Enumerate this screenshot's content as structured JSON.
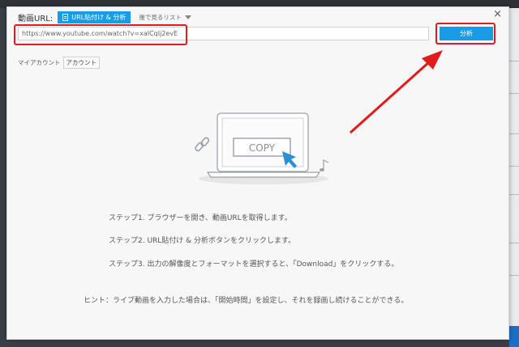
{
  "dialog": {
    "url_label": "動画URL:",
    "tabs": [
      {
        "label": "URL貼付け & 分析",
        "active": true
      },
      {
        "label": "後で見るリスト",
        "active": false
      }
    ],
    "url_value": "https://www.youtube.com/watch?v=xaICqIj2evE",
    "analyze_label": "分析",
    "account": {
      "label": "マイアカウント",
      "button": "アカウント"
    },
    "copy_label": "COPY",
    "steps": [
      "ステップ1. ブラウザーを開き、動画URLを取得します。",
      "ステップ2. URL貼付け & 分析ボタンをクリックします。",
      "ステップ3. 出力の解像度とフォーマットを選択すると、「Download」をクリックする。"
    ],
    "hint": "ヒント：ライブ動画を入力した場合は、「開始時間」を設定し、それを録画し続けることができる。",
    "close_glyph": "×"
  },
  "colors": {
    "accent": "#1a9be6",
    "annotation_red": "#e21b1b",
    "dialog_bg": "#f7f7f7"
  },
  "icons": [
    "close-icon",
    "paste-icon",
    "dropdown-caret-icon",
    "laptop-icon",
    "cursor-icon",
    "link-icon",
    "music-note-icon"
  ]
}
